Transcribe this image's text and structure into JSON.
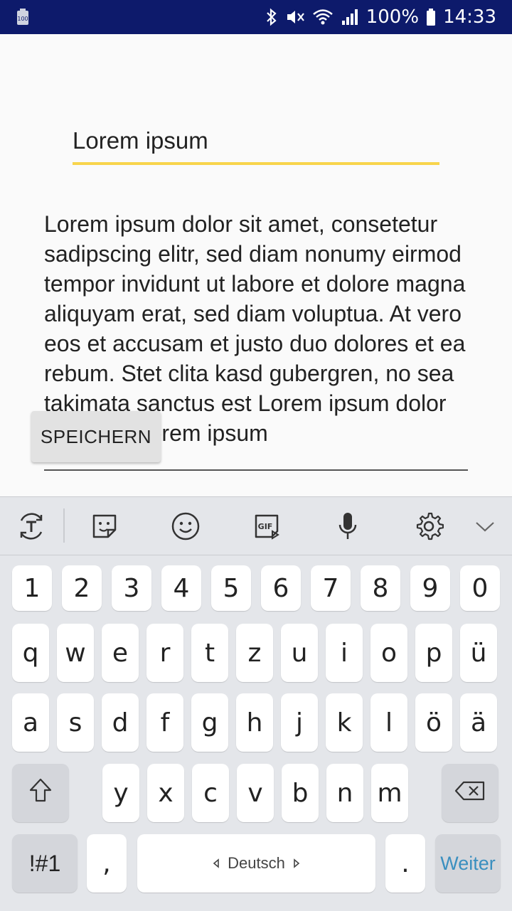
{
  "status_bar": {
    "battery_percent": "100%",
    "time": "14:33",
    "left_icon": "battery-100-icon",
    "icons": [
      "bluetooth-icon",
      "mute-icon",
      "wifi-icon",
      "signal-icon",
      "battery-icon"
    ]
  },
  "editor": {
    "title_value": "Lorem ipsum",
    "body_value": "Lorem ipsum dolor sit amet, consetetur sadipscing elitr, sed diam nonumy eirmod tempor invidunt ut labore et dolore magna aliquyam erat, sed diam voluptua. At vero eos et accusam et justo duo dolores et ea rebum. Stet clita kasd gubergren, no sea takimata sanctus est Lorem ipsum dolor sit amet. Lorem ipsum",
    "save_label": "SPEICHERN",
    "accent_color": "#f8d44c"
  },
  "keyboard": {
    "toolbar_icons": [
      "translate-icon",
      "sticker-icon",
      "emoji-icon",
      "gif-icon",
      "microphone-icon",
      "settings-gear-icon",
      "collapse-chevron-icon"
    ],
    "number_row": [
      "1",
      "2",
      "3",
      "4",
      "5",
      "6",
      "7",
      "8",
      "9",
      "0"
    ],
    "row1": [
      "q",
      "w",
      "e",
      "r",
      "t",
      "z",
      "u",
      "i",
      "o",
      "p",
      "ü"
    ],
    "row2": [
      "a",
      "s",
      "d",
      "f",
      "g",
      "h",
      "j",
      "k",
      "l",
      "ö",
      "ä"
    ],
    "row3": [
      "y",
      "x",
      "c",
      "v",
      "b",
      "n",
      "m"
    ],
    "symbols_label": "!#1",
    "comma_label": ",",
    "space_label": "Deutsch",
    "period_label": ".",
    "enter_label": "Weiter"
  }
}
